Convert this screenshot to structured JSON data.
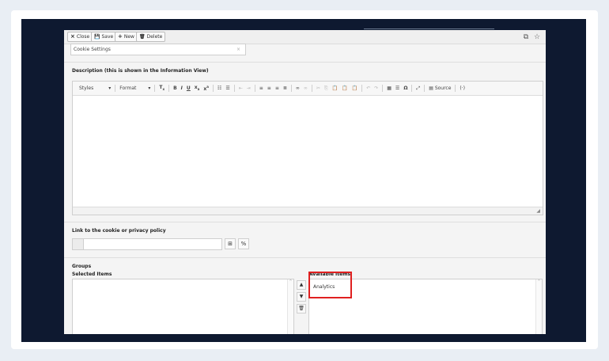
{
  "toolbar": {
    "close_label": "Close",
    "save_label": "Save",
    "new_label": "New",
    "delete_label": "Delete",
    "close_icon": "×",
    "save_icon": "💾",
    "new_icon": "+",
    "delete_icon": "🗑",
    "open_external_icon": "⧉",
    "bookmark_icon": "☆"
  },
  "title_field": {
    "value": "Cookie Settings",
    "clear_icon": "×"
  },
  "description": {
    "label": "Description (this is shown in the Information View)",
    "styles_label": "Styles",
    "format_label": "Format",
    "source_label": "Source",
    "resize_icon": "◢"
  },
  "link": {
    "label": "Link to the cookie or privacy policy",
    "browse_icon": "⊞",
    "unlink_icon": "%"
  },
  "groups": {
    "label": "Groups",
    "selected_label": "Selected Items",
    "available_label": "Available Items",
    "available_items": [
      "Analytics"
    ],
    "move_up_icon": "▲",
    "move_down_icon": "▼",
    "remove_icon": "🗑",
    "scroll_icon": "^"
  },
  "colors": {
    "highlight": "#e02020",
    "backdrop": "#0e1930"
  }
}
